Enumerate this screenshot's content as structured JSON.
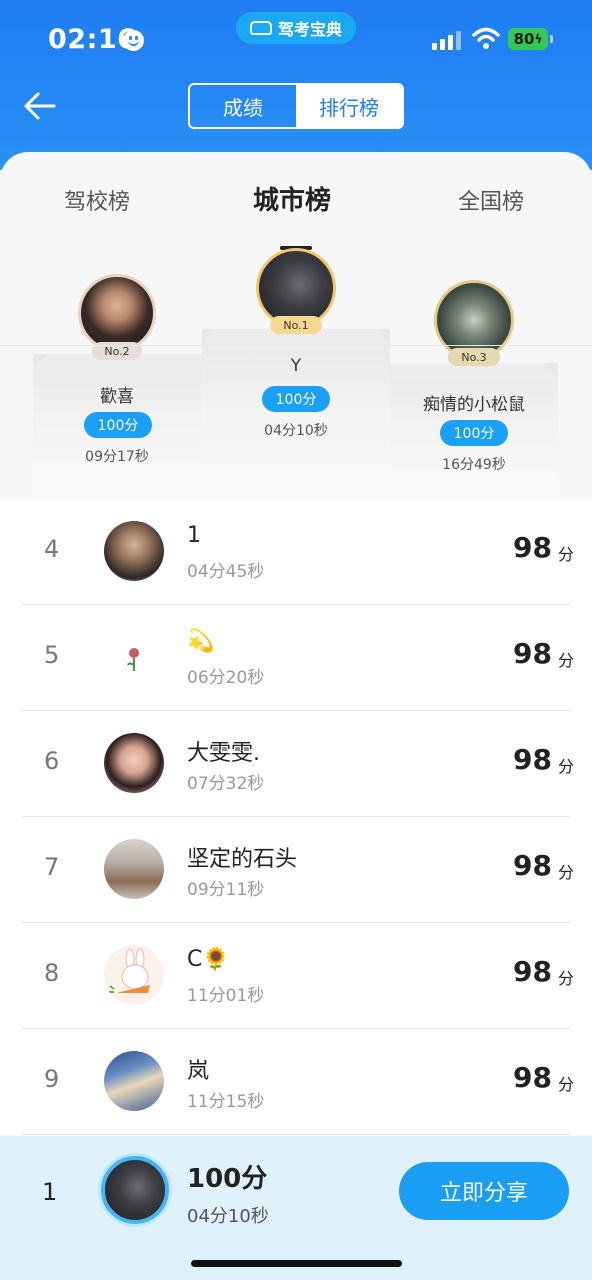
{
  "status": {
    "time": "02:16",
    "app_name": "驾考宝典",
    "battery": "80"
  },
  "header": {
    "segments": [
      {
        "label": "成绩",
        "active": false
      },
      {
        "label": "排行榜",
        "active": true
      }
    ]
  },
  "tabs": [
    {
      "label": "驾校榜",
      "active": false
    },
    {
      "label": "城市榜",
      "active": true
    },
    {
      "label": "全国榜",
      "active": false
    }
  ],
  "podium": {
    "first": {
      "badge": "No.1",
      "name": "Y",
      "score": "100分",
      "time": "04分10秒"
    },
    "second": {
      "badge": "No.2",
      "name": "歡喜",
      "score": "100分",
      "time": "09分17秒"
    },
    "third": {
      "badge": "No.3",
      "name": "痴情的小松鼠",
      "score": "100分",
      "time": "16分49秒"
    }
  },
  "list": [
    {
      "rank": "4",
      "name": "1",
      "time": "04分45秒",
      "score": "98",
      "unit": "分"
    },
    {
      "rank": "5",
      "name": "💫",
      "time": "06分20秒",
      "score": "98",
      "unit": "分"
    },
    {
      "rank": "6",
      "name": "大雯雯.",
      "time": "07分32秒",
      "score": "98",
      "unit": "分"
    },
    {
      "rank": "7",
      "name": "坚定的石头",
      "time": "09分11秒",
      "score": "98",
      "unit": "分"
    },
    {
      "rank": "8",
      "name": "C🌻",
      "time": "11分01秒",
      "score": "98",
      "unit": "分"
    },
    {
      "rank": "9",
      "name": "岚",
      "time": "11分15秒",
      "score": "98",
      "unit": "分"
    }
  ],
  "me": {
    "rank": "1",
    "score": "100分",
    "time": "04分10秒",
    "share_label": "立即分享"
  },
  "colors": {
    "header_blue": "#1f7cf3",
    "accent_blue": "#1aa0f4",
    "bottom_bar": "#dff2fc"
  }
}
